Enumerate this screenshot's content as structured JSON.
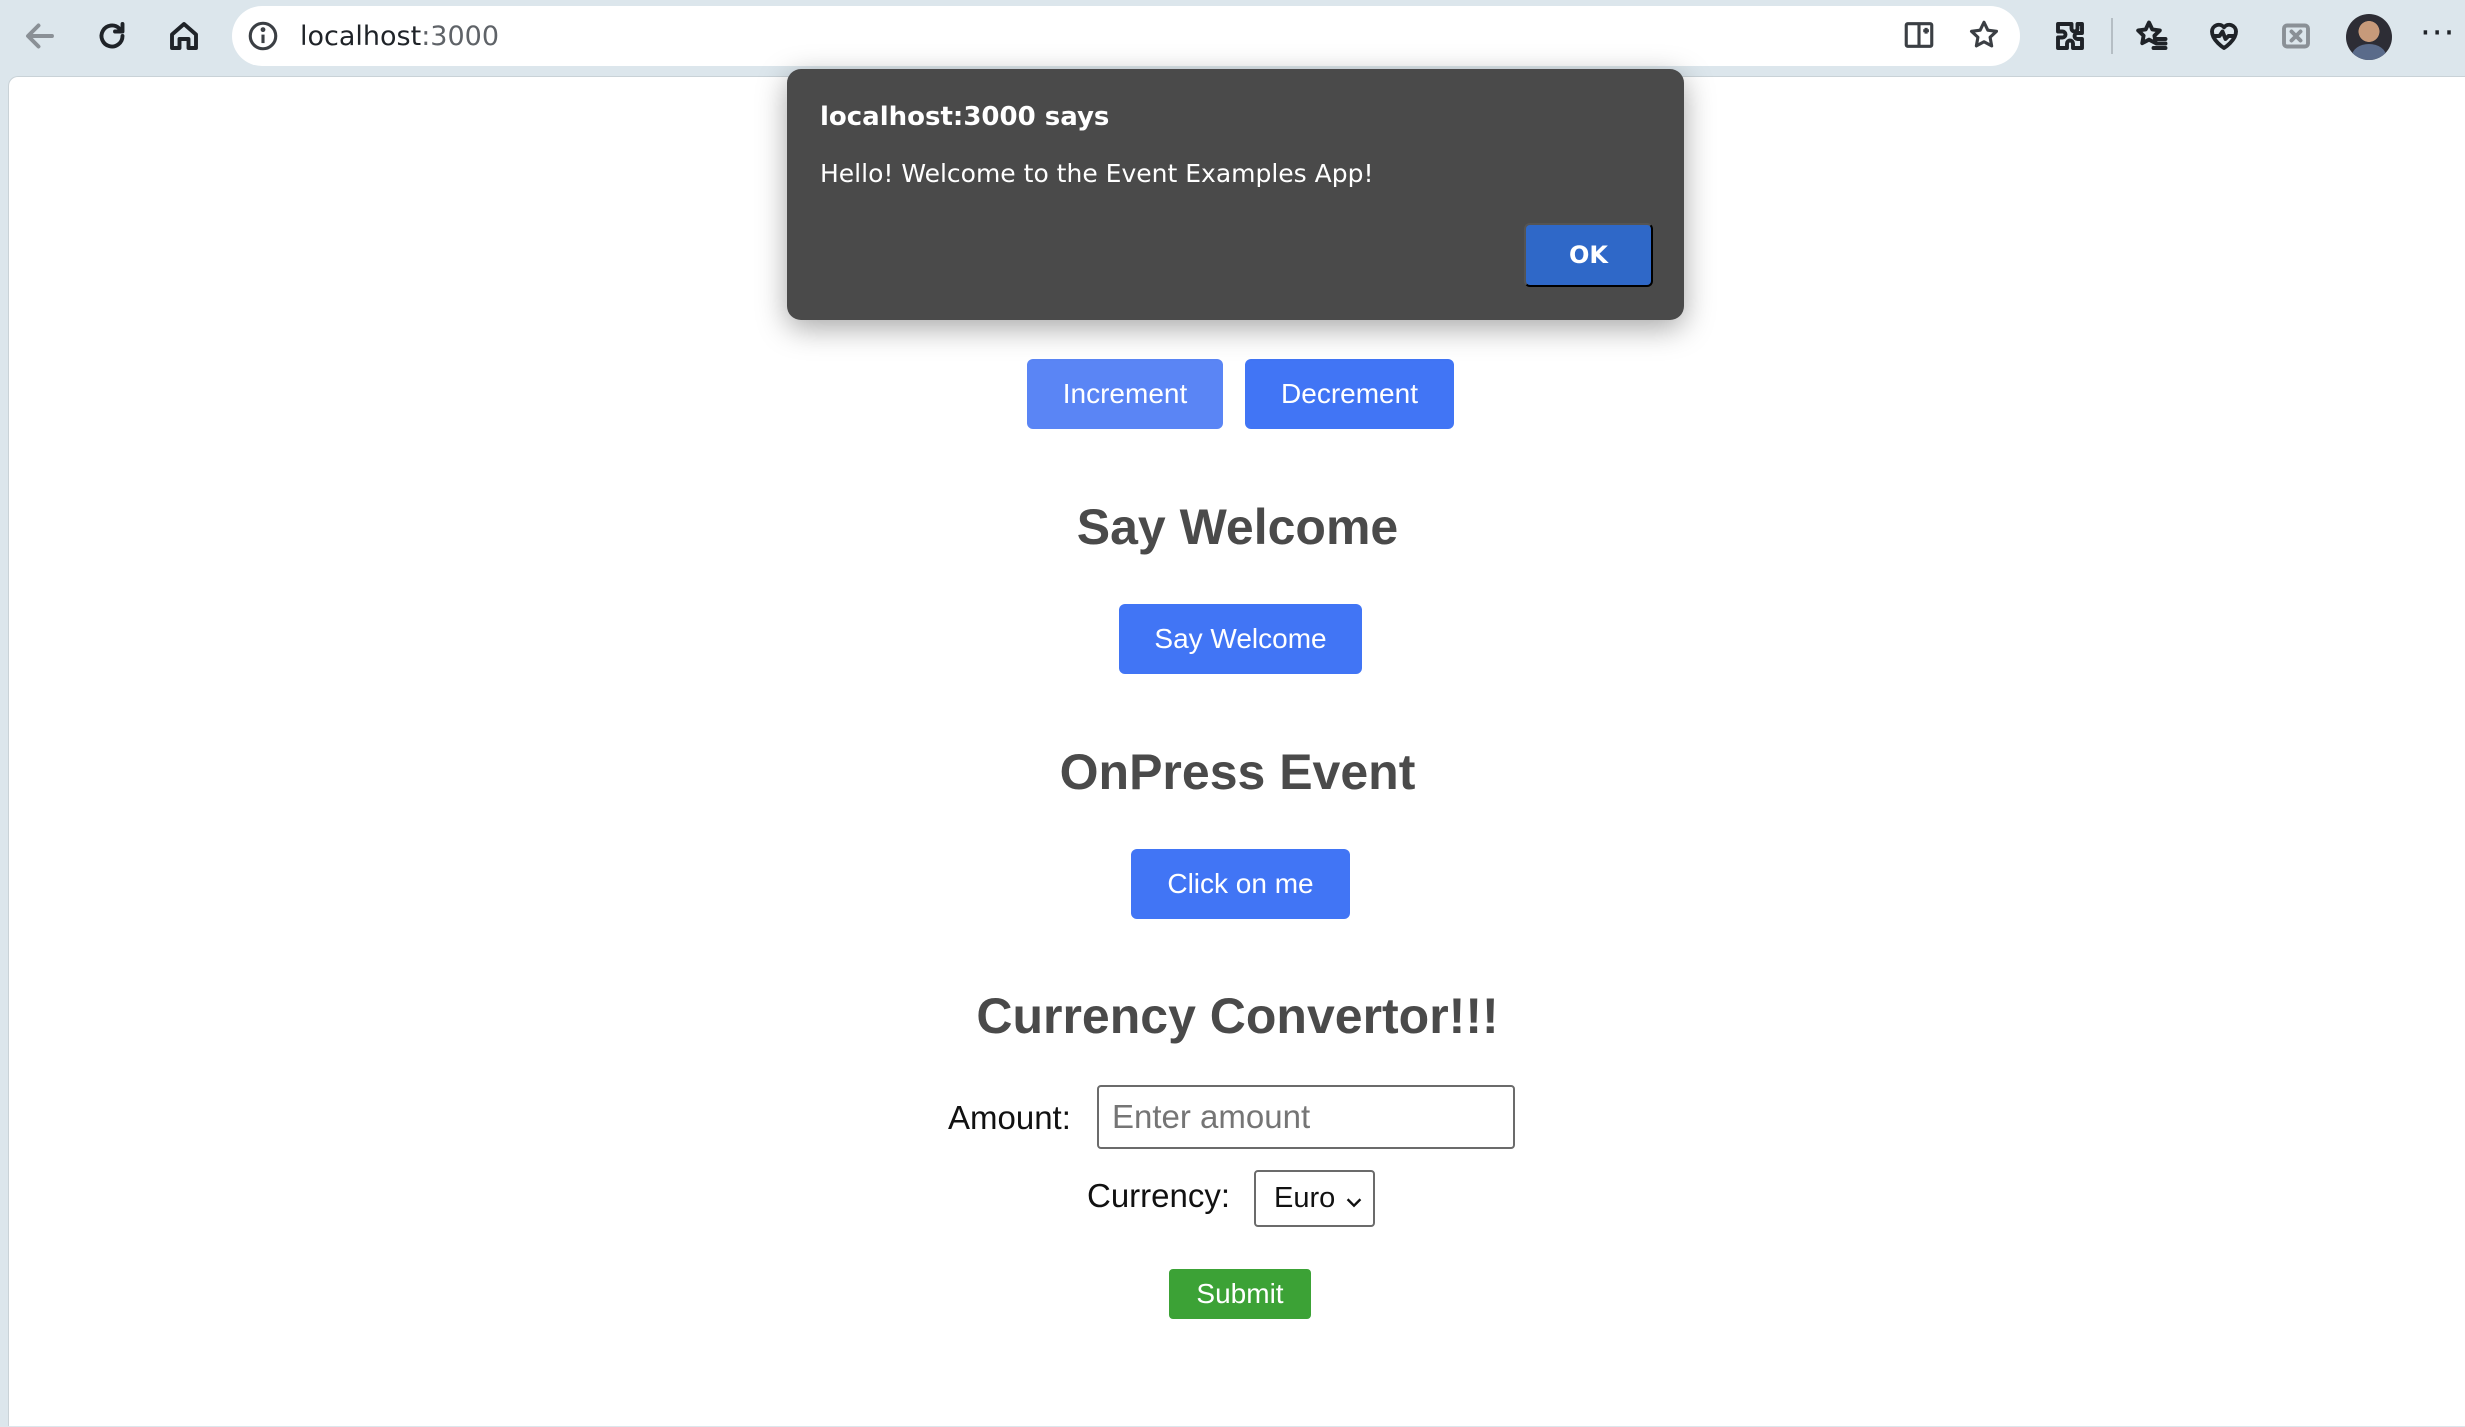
{
  "browser": {
    "url_host": "localhost",
    "url_port": ":3000",
    "toolbar_icons": [
      "back-icon",
      "refresh-icon",
      "home-icon",
      "site-info-icon",
      "split-screen-icon",
      "favorite-star-icon",
      "extensions-icon",
      "favorites-icon",
      "browser-essentials-icon",
      "collections-icon",
      "profile-avatar",
      "more-menu-icon"
    ],
    "more_label": "···"
  },
  "alert": {
    "title": "localhost:3000 says",
    "message": "Hello! Welcome to the Event Examples App!",
    "ok_label": "OK"
  },
  "counter": {
    "increment_label": "Increment",
    "decrement_label": "Decrement"
  },
  "welcome": {
    "heading": "Say Welcome",
    "button_label": "Say Welcome"
  },
  "onpress": {
    "heading": "OnPress Event",
    "button_label": "Click on me"
  },
  "currency": {
    "heading": "Currency Convertor!!!",
    "amount_label": "Amount:",
    "amount_placeholder": "Enter amount",
    "amount_value": "",
    "currency_label": "Currency:",
    "currency_selected": "Euro",
    "submit_label": "Submit"
  },
  "colors": {
    "primary_button": "#4175f5",
    "submit_button": "#3ca236",
    "dialog_bg": "#4a4a4a",
    "dialog_ok": "#2f68c8"
  }
}
